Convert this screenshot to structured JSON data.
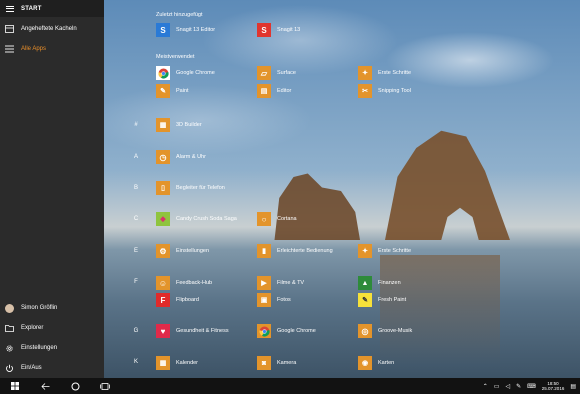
{
  "start": {
    "title": "START",
    "nav": [
      {
        "label": "Angeheftete Kacheln",
        "icon": "tiles-icon"
      },
      {
        "label": "Alle Apps",
        "icon": "list-icon"
      }
    ],
    "bottom": [
      {
        "label": "Simon Gröflin",
        "icon": "avatar"
      },
      {
        "label": "Explorer",
        "icon": "folder-icon"
      },
      {
        "label": "Einstellungen",
        "icon": "gear-icon"
      },
      {
        "label": "Ein/Aus",
        "icon": "power-icon"
      }
    ]
  },
  "recent": {
    "title": "Zuletzt hinzugefügt",
    "apps": [
      {
        "name": "Snagit 13 Editor",
        "color": "#2a7ad6",
        "glyph": "S"
      },
      {
        "name": "Snagit 13",
        "color": "#e1352e",
        "glyph": "S"
      }
    ]
  },
  "most_used": {
    "title": "Meistverwendet",
    "apps": [
      {
        "name": "Google Chrome",
        "color": "#ffffff",
        "glyph": "●"
      },
      {
        "name": "Surface",
        "color": "#e3942b",
        "glyph": "▱"
      },
      {
        "name": "Erste Schritte",
        "color": "#e3942b",
        "glyph": "✦"
      },
      {
        "name": "Paint",
        "color": "#e3942b",
        "glyph": "✎"
      },
      {
        "name": "Editor",
        "color": "#e3942b",
        "glyph": "▤"
      },
      {
        "name": "Snipping Tool",
        "color": "#e3942b",
        "glyph": "✂"
      }
    ]
  },
  "groups": [
    {
      "letter": "#",
      "apps": [
        {
          "name": "3D Builder",
          "color": "#e3942b",
          "glyph": "▦"
        }
      ]
    },
    {
      "letter": "A",
      "apps": [
        {
          "name": "Alarm & Uhr",
          "color": "#e3942b",
          "glyph": "◷"
        }
      ]
    },
    {
      "letter": "B",
      "apps": [
        {
          "name": "Begleiter für Telefon",
          "color": "#e3942b",
          "glyph": "▯"
        }
      ]
    },
    {
      "letter": "C",
      "apps": [
        {
          "name": "Candy Crush Soda Saga",
          "color": "#8fc43e",
          "glyph": "◆"
        },
        {
          "name": "Cortana",
          "color": "#e3942b",
          "glyph": "○"
        }
      ]
    },
    {
      "letter": "E",
      "apps": [
        {
          "name": "Einstellungen",
          "color": "#e3942b",
          "glyph": "⚙"
        },
        {
          "name": "Erleichterte Bedienung",
          "color": "#e3942b",
          "glyph": "▮"
        },
        {
          "name": "Erste Schritte",
          "color": "#e3942b",
          "glyph": "✦"
        }
      ]
    },
    {
      "letter": "F",
      "apps": [
        {
          "name": "Feedback-Hub",
          "color": "#e3942b",
          "glyph": "☺"
        },
        {
          "name": "Filme & TV",
          "color": "#e3942b",
          "glyph": "▶"
        },
        {
          "name": "Finanzen",
          "color": "#2e8b3a",
          "glyph": "▲"
        },
        {
          "name": "Flipboard",
          "color": "#e02a2a",
          "glyph": "F"
        },
        {
          "name": "Fotos",
          "color": "#e3942b",
          "glyph": "▣"
        },
        {
          "name": "Fresh Paint",
          "color": "#f6e13a",
          "glyph": "✎"
        }
      ]
    },
    {
      "letter": "G",
      "apps": [
        {
          "name": "Gesundheit & Fitness",
          "color": "#e02a4a",
          "glyph": "♥"
        },
        {
          "name": "Google Chrome",
          "color": "#ffffff",
          "glyph": "●"
        },
        {
          "name": "Groove-Musik",
          "color": "#e3942b",
          "glyph": "◎"
        }
      ]
    },
    {
      "letter": "K",
      "apps": [
        {
          "name": "Kalender",
          "color": "#e3942b",
          "glyph": "▦"
        },
        {
          "name": "Kamera",
          "color": "#e3942b",
          "glyph": "◙"
        },
        {
          "name": "Karten",
          "color": "#e3942b",
          "glyph": "◉"
        }
      ]
    }
  ],
  "taskbar": {
    "time": "18:50",
    "date": "25.07.2016"
  }
}
